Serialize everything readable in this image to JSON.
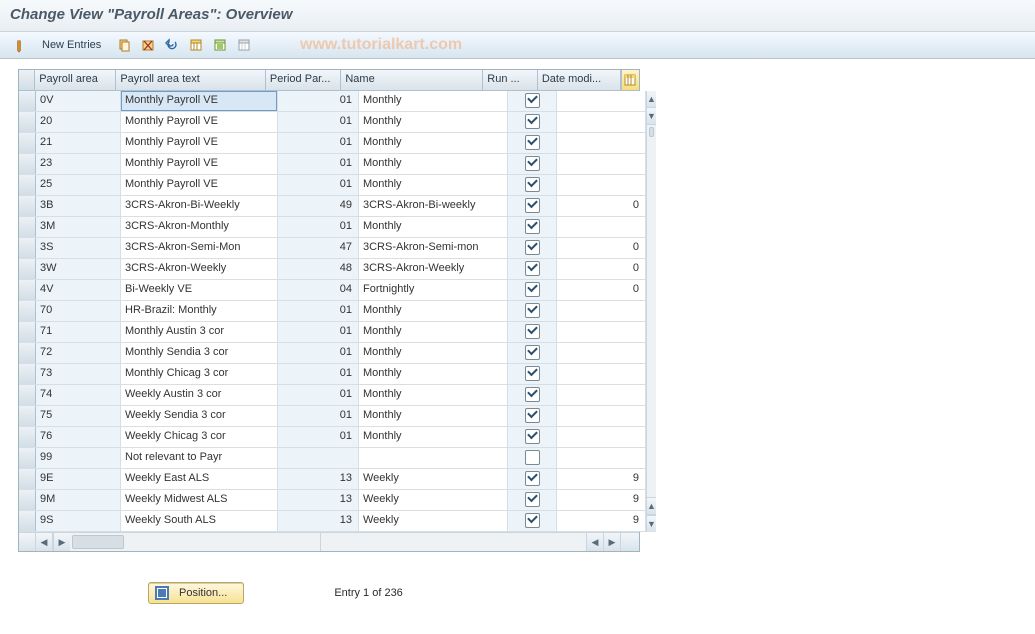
{
  "title": "Change View \"Payroll Areas\": Overview",
  "watermark": "www.tutorialkart.com",
  "toolbar": {
    "new_entries_label": "New Entries"
  },
  "columns": {
    "payroll_area": "Payroll area",
    "payroll_area_text": "Payroll area text",
    "period_par": "Period Par...",
    "name": "Name",
    "run": "Run ...",
    "date_modi": "Date modi..."
  },
  "rows": [
    {
      "area": "0V",
      "text": "Monthly Payroll  VE",
      "period": "01",
      "name": "Monthly",
      "run": true,
      "date": "",
      "selected": true
    },
    {
      "area": "20",
      "text": "Monthly Payroll  VE",
      "period": "01",
      "name": "Monthly",
      "run": true,
      "date": ""
    },
    {
      "area": "21",
      "text": "Monthly Payroll  VE",
      "period": "01",
      "name": "Monthly",
      "run": true,
      "date": ""
    },
    {
      "area": "23",
      "text": "Monthly Payroll  VE",
      "period": "01",
      "name": "Monthly",
      "run": true,
      "date": ""
    },
    {
      "area": "25",
      "text": "Monthly Payroll  VE",
      "period": "01",
      "name": "Monthly",
      "run": true,
      "date": ""
    },
    {
      "area": "3B",
      "text": "3CRS-Akron-Bi-Weekly",
      "period": "49",
      "name": "3CRS-Akron-Bi-weekly",
      "run": true,
      "date": "0"
    },
    {
      "area": "3M",
      "text": "3CRS-Akron-Monthly",
      "period": "01",
      "name": "Monthly",
      "run": true,
      "date": ""
    },
    {
      "area": "3S",
      "text": "3CRS-Akron-Semi-Mon",
      "period": "47",
      "name": "3CRS-Akron-Semi-mon",
      "run": true,
      "date": "0"
    },
    {
      "area": "3W",
      "text": "3CRS-Akron-Weekly",
      "period": "48",
      "name": "3CRS-Akron-Weekly",
      "run": true,
      "date": "0"
    },
    {
      "area": "4V",
      "text": "Bi-Weekly VE",
      "period": "04",
      "name": "Fortnightly",
      "run": true,
      "date": "0"
    },
    {
      "area": "70",
      "text": "HR-Brazil: Monthly",
      "period": "01",
      "name": "Monthly",
      "run": true,
      "date": ""
    },
    {
      "area": "71",
      "text": "Monthly Austin 3 cor",
      "period": "01",
      "name": "Monthly",
      "run": true,
      "date": ""
    },
    {
      "area": "72",
      "text": "Monthly Sendia 3 cor",
      "period": "01",
      "name": "Monthly",
      "run": true,
      "date": ""
    },
    {
      "area": "73",
      "text": "Monthly Chicag 3 cor",
      "period": "01",
      "name": "Monthly",
      "run": true,
      "date": ""
    },
    {
      "area": "74",
      "text": "Weekly Austin 3 cor",
      "period": "01",
      "name": "Monthly",
      "run": true,
      "date": ""
    },
    {
      "area": "75",
      "text": "Weekly Sendia 3 cor",
      "period": "01",
      "name": "Monthly",
      "run": true,
      "date": ""
    },
    {
      "area": "76",
      "text": "Weekly Chicag 3 cor",
      "period": "01",
      "name": "Monthly",
      "run": true,
      "date": ""
    },
    {
      "area": "99",
      "text": "Not relevant to Payr",
      "period": "",
      "name": "",
      "run": false,
      "date": ""
    },
    {
      "area": "9E",
      "text": "Weekly East ALS",
      "period": "13",
      "name": "Weekly",
      "run": true,
      "date": "9"
    },
    {
      "area": "9M",
      "text": "Weekly Midwest ALS",
      "period": "13",
      "name": "Weekly",
      "run": true,
      "date": "9"
    },
    {
      "area": "9S",
      "text": "Weekly South ALS",
      "period": "13",
      "name": "Weekly",
      "run": true,
      "date": "9"
    }
  ],
  "footer": {
    "position_label": "Position...",
    "entry_text": "Entry 1 of 236"
  },
  "col_widths": {
    "area": 76,
    "text": 148,
    "period": 70,
    "name": 140,
    "run": 48,
    "date": 78
  }
}
